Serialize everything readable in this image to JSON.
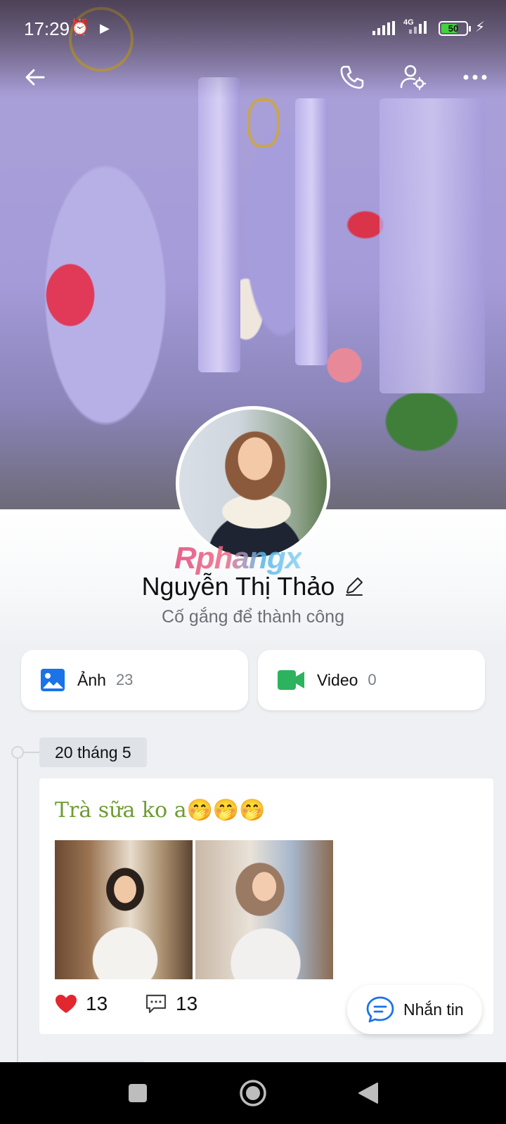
{
  "status_bar": {
    "time": "17:29",
    "network": "4G",
    "battery_level": "50"
  },
  "profile": {
    "name": "Nguyễn Thị Thảo",
    "bio": "Cố gắng để thành công",
    "watermark": "Rphangx"
  },
  "media": {
    "photos_label": "Ảnh",
    "photos_count": "23",
    "videos_label": "Video",
    "videos_count": "0"
  },
  "timeline": {
    "date": "20 tháng 5",
    "post": {
      "caption": "Trà sữa ko a🤭🤭🤭",
      "likes": "13",
      "comments": "13"
    }
  },
  "message_button": {
    "label": "Nhắn tin"
  },
  "colors": {
    "accent_blue": "#1a73e8",
    "video_green": "#2db35d",
    "like_red": "#e2272f",
    "caption_green": "#6e9b34"
  },
  "icons": {
    "back": "arrow-left-icon",
    "call": "phone-icon",
    "settings": "user-settings-icon",
    "more": "more-horizontal-icon",
    "edit": "pencil-icon",
    "photo": "image-icon",
    "video": "video-camera-icon",
    "like": "heart-icon",
    "comment": "comment-icon",
    "message": "chat-bubble-icon"
  }
}
